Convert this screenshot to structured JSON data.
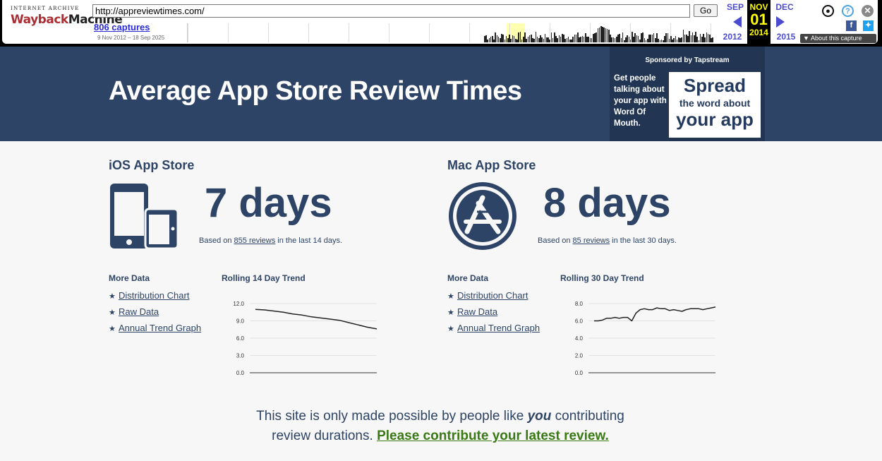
{
  "wayback": {
    "logo_top": "INTERNET ARCHIVE",
    "logo_main_a": "Wayback",
    "logo_main_b": "Machine",
    "url": "http://appreviewtimes.com/",
    "go_label": "Go",
    "captures": "806 captures",
    "range": "9 Nov 2012 – 18 Sep 2025",
    "prev_month": "SEP",
    "prev_year": "2012",
    "cur_month": "NOV",
    "cur_day": "01",
    "cur_year": "2014",
    "next_month": "DEC",
    "next_year": "2015",
    "about": "About this capture",
    "icons": {
      "user": "user-circle-icon",
      "help": "help-icon",
      "close": "close-icon",
      "facebook": "facebook-icon",
      "twitter": "twitter-icon"
    }
  },
  "header": {
    "title": "Average App Store Review Times",
    "sponsor_label": "Sponsored by Tapstream",
    "sponsor_text": "Get people talking about your app with Word Of Mouth.",
    "ad_line1": "Spread",
    "ad_line2": "the word about",
    "ad_line3": "your app"
  },
  "ios": {
    "title": "iOS App Store",
    "days": "7 days",
    "based_prefix": "Based on ",
    "reviews_link": "855 reviews",
    "based_suffix": " in the last 14 days.",
    "more_title": "More Data",
    "links": [
      "Distribution Chart",
      "Raw Data",
      "Annual Trend Graph"
    ],
    "trend_title": "Rolling 14 Day Trend"
  },
  "mac": {
    "title": "Mac App Store",
    "days": "8 days",
    "based_prefix": "Based on ",
    "reviews_link": "85 reviews",
    "based_suffix": " in the last 30 days.",
    "more_title": "More Data",
    "links": [
      "Distribution Chart",
      "Raw Data",
      "Annual Trend Graph"
    ],
    "trend_title": "Rolling 30 Day Trend"
  },
  "footer": {
    "text_a": "This site is only made possible by people like ",
    "text_em": "you",
    "text_b": " contributing review durations. ",
    "link": "Please contribute your latest review."
  },
  "colors": {
    "navy": "#2e4466",
    "link_green": "#3a7a14",
    "background": "#f7f7f7"
  },
  "chart_data": [
    {
      "type": "line",
      "ylim": [
        0,
        12
      ],
      "yticks": [
        "12.0",
        "9.0",
        "6.0",
        "3.0",
        "0.0"
      ],
      "ytick_values": [
        12,
        9,
        6,
        3,
        0
      ],
      "x": [
        1,
        2,
        3,
        4,
        5,
        6,
        7,
        8,
        9,
        10,
        11,
        12,
        13,
        14
      ],
      "values": [
        11.0,
        10.9,
        10.7,
        10.5,
        10.2,
        10.0,
        9.7,
        9.5,
        9.3,
        9.1,
        8.7,
        8.3,
        7.9,
        7.6
      ]
    },
    {
      "type": "line",
      "ylim": [
        0,
        8
      ],
      "yticks": [
        "8.0",
        "6.0",
        "4.0",
        "2.0",
        "0.0"
      ],
      "ytick_values": [
        8,
        6,
        4,
        2,
        0
      ],
      "x": [
        1,
        2,
        3,
        4,
        5,
        6,
        7,
        8,
        9,
        10,
        11,
        12,
        13,
        14,
        15,
        16,
        17,
        18,
        19,
        20,
        21,
        22,
        23,
        24,
        25,
        26,
        27,
        28,
        29,
        30
      ],
      "values": [
        6.0,
        6.0,
        6.1,
        6.3,
        6.3,
        6.4,
        6.3,
        6.4,
        6.4,
        6.0,
        6.9,
        7.3,
        7.4,
        7.3,
        7.3,
        7.5,
        7.4,
        7.4,
        7.2,
        7.3,
        7.2,
        7.1,
        7.3,
        7.4,
        7.4,
        7.4,
        7.3,
        7.4,
        7.5,
        7.6
      ]
    }
  ]
}
